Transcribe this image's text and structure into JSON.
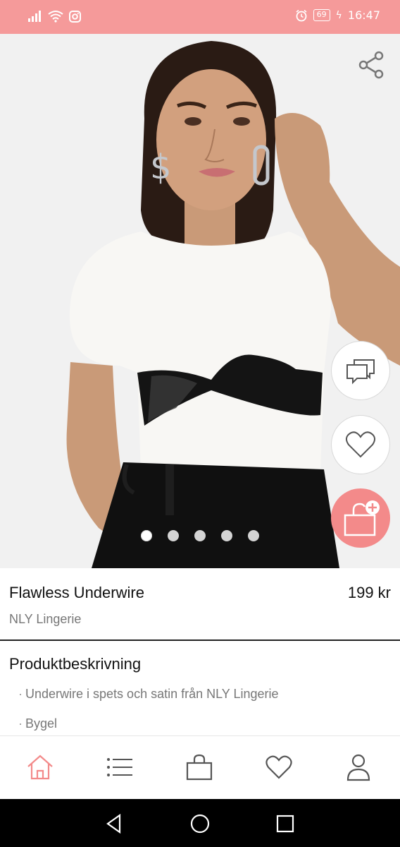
{
  "status": {
    "time": "16:47",
    "battery": "69"
  },
  "product": {
    "name": "Flawless Underwire",
    "price": "199 kr",
    "brand": "NLY Lingerie"
  },
  "description": {
    "title": "Produktbeskrivning",
    "items": [
      "Underwire i spets och satin från NLY Lingerie",
      "Bygel"
    ]
  },
  "carousel": {
    "count": 5,
    "active_index": 1
  },
  "icons": {
    "share": "share-icon",
    "chat": "chat-icon",
    "favorite": "heart-icon",
    "add_to_cart": "bag-plus-icon",
    "nav": [
      "home-icon",
      "menu-list-icon",
      "bag-icon",
      "heart-icon",
      "user-icon"
    ]
  },
  "colors": {
    "accent": "#f38a8a",
    "status_bar": "#f59a9a"
  }
}
